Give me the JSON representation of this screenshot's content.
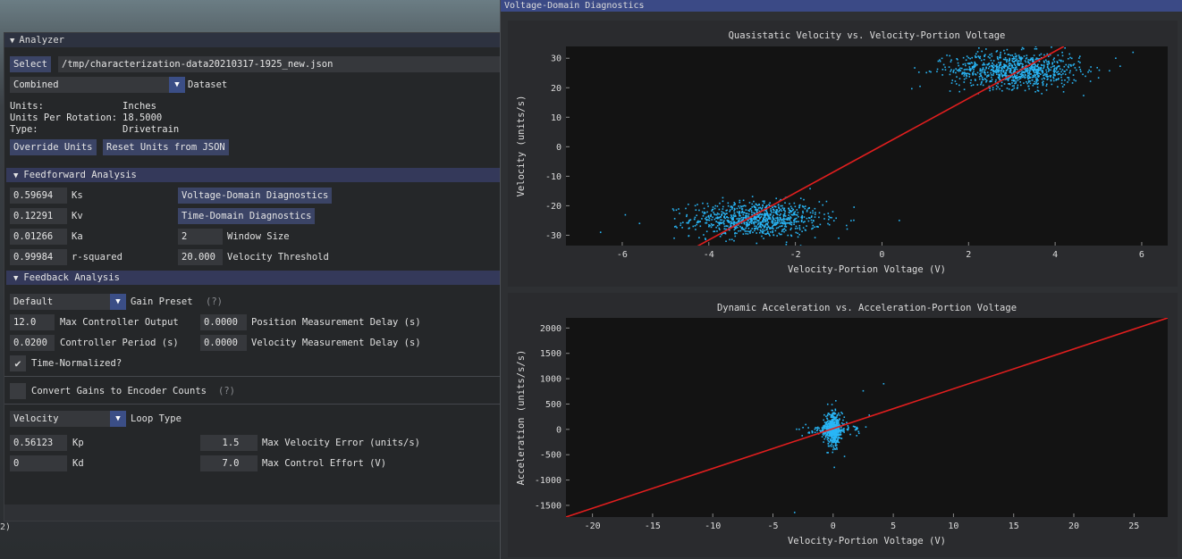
{
  "background_text": "2)",
  "analyzer": {
    "title": "Analyzer",
    "select_label": "Select",
    "file_path": "/tmp/characterization-data20210317-1925_new.json",
    "dataset_value": "Combined",
    "dataset_label": "Dataset",
    "units_label": "Units:",
    "units_value": "Inches",
    "upr_label": "Units Per Rotation:",
    "upr_value": "18.5000",
    "type_label": "Type:",
    "type_value": "Drivetrain",
    "override_units": "Override Units",
    "reset_units": "Reset Units from JSON",
    "feedforward": {
      "header": "Feedforward Analysis",
      "ks_value": "0.59694",
      "ks_label": "Ks",
      "kv_value": "0.12291",
      "kv_label": "Kv",
      "ka_value": "0.01266",
      "ka_label": "Ka",
      "r2_value": "0.99984",
      "r2_label": "r-squared",
      "vdd_button": "Voltage-Domain Diagnostics",
      "tdd_button": "Time-Domain Diagnostics",
      "window_value": "2",
      "window_label": "Window Size",
      "vel_thresh_value": "20.000",
      "vel_thresh_label": "Velocity Threshold"
    },
    "feedback": {
      "header": "Feedback Analysis",
      "gain_preset_value": "Default",
      "gain_preset_label": "Gain Preset",
      "help": "(?)",
      "max_output_value": "12.0",
      "max_output_label": "Max Controller Output",
      "period_value": "0.0200",
      "period_label": "Controller Period (s)",
      "pos_delay_value": "0.0000",
      "pos_delay_label": "Position Measurement Delay (s)",
      "vel_delay_value": "0.0000",
      "vel_delay_label": "Velocity Measurement Delay (s)",
      "time_normalized_label": "Time-Normalized?",
      "time_normalized_checked": true,
      "convert_gains_label": "Convert Gains to Encoder Counts",
      "convert_gains_checked": false,
      "loop_type_value": "Velocity",
      "loop_type_label": "Loop Type",
      "kp_value": "0.56123",
      "kp_label": "Kp",
      "kd_value": "0",
      "kd_label": "Kd",
      "max_vel_err_value": "1.5",
      "max_vel_err_label": "Max Velocity Error (units/s)",
      "max_effort_value": "7.0",
      "max_effort_label": "Max Control Effort (V)"
    }
  },
  "vdd": {
    "title": "Voltage-Domain Diagnostics"
  },
  "chart_data": [
    {
      "type": "scatter",
      "title": "Quasistatic Velocity vs. Velocity-Portion Voltage",
      "xlabel": "Velocity-Portion Voltage (V)",
      "ylabel": "Velocity (units/s)",
      "xlim": [
        -7.3,
        6.6
      ],
      "ylim": [
        -33.5,
        34
      ],
      "xticks": [
        -6,
        -4,
        -2,
        0,
        2,
        4,
        6
      ],
      "yticks": [
        30,
        20,
        10,
        0,
        -10,
        -20,
        -30
      ],
      "point_color": "#29b6f6",
      "fit_color": "#e01e1e",
      "fit_line": {
        "x": [
          -4.3,
          4.2
        ],
        "y": [
          -34,
          34
        ]
      },
      "series": [
        {
          "cluster_center": [
            -2.9,
            -24.5
          ],
          "cluster_spread": [
            0.75,
            3.0
          ],
          "count": 900
        },
        {
          "cluster_center": [
            3.1,
            26.0
          ],
          "cluster_spread": [
            0.75,
            3.0
          ],
          "count": 900
        }
      ],
      "outliers": [
        [
          -6.5,
          -29
        ],
        [
          -5.6,
          -26
        ],
        [
          -4.8,
          -31
        ],
        [
          -2.5,
          -30
        ],
        [
          -1.0,
          -31
        ],
        [
          0.4,
          -25
        ],
        [
          -1.2,
          -24
        ],
        [
          1.3,
          29
        ],
        [
          1.5,
          31
        ],
        [
          5.8,
          32
        ],
        [
          5.4,
          30
        ]
      ]
    },
    {
      "type": "scatter",
      "title": "Dynamic Acceleration vs. Acceleration-Portion Voltage",
      "xlabel": "Velocity-Portion Voltage (V)",
      "ylabel": "Acceleration (units/s/s)",
      "xlim": [
        -22.2,
        27.8
      ],
      "ylim": [
        -1730,
        2200
      ],
      "xticks": [
        -20,
        -15,
        -10,
        -5,
        0,
        5,
        10,
        15,
        20,
        25
      ],
      "yticks": [
        2000,
        1500,
        1000,
        500,
        0,
        -500,
        -1000,
        -1500
      ],
      "point_color": "#29b6f6",
      "fit_color": "#e01e1e",
      "fit_line": {
        "x": [
          -22.2,
          27.8
        ],
        "y": [
          -1730,
          2200
        ]
      },
      "series": [
        {
          "cluster_center": [
            0.0,
            0.0
          ],
          "cluster_spread": [
            0.35,
            160
          ],
          "count": 500
        },
        {
          "cluster_center": [
            0.0,
            0.0
          ],
          "cluster_spread": [
            1.2,
            60
          ],
          "count": 120
        }
      ],
      "outliers": [
        [
          2.5,
          760
        ],
        [
          4.2,
          900
        ],
        [
          0.1,
          -750
        ],
        [
          -3.2,
          -1640
        ],
        [
          3.0,
          280
        ],
        [
          -1.5,
          -60
        ],
        [
          1.8,
          50
        ]
      ]
    }
  ]
}
